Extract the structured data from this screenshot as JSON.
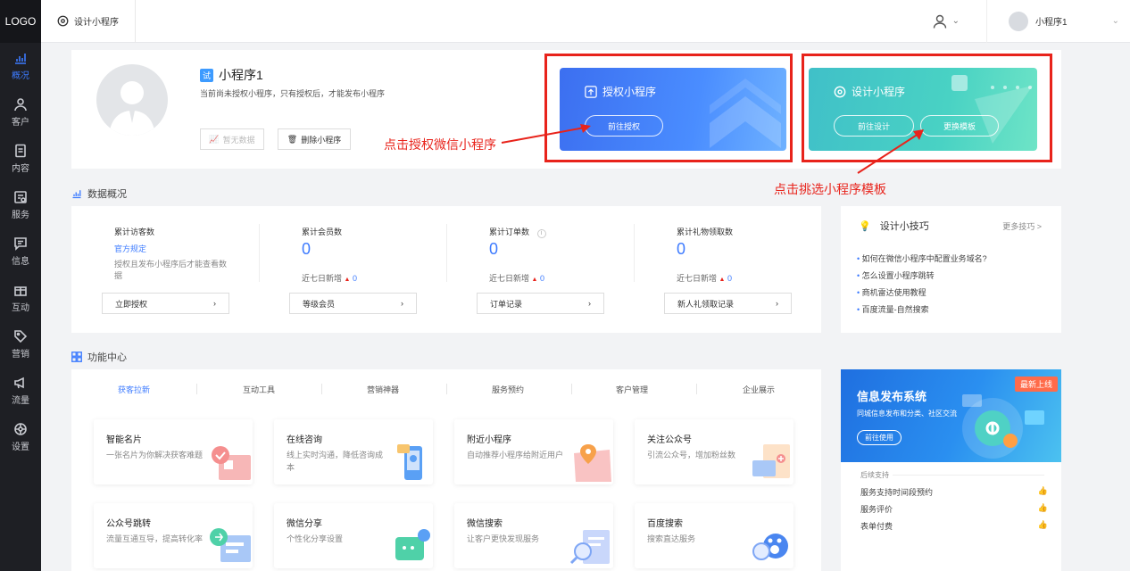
{
  "sidebar": {
    "logo": "LOGO",
    "items": [
      {
        "label": "概况",
        "icon": "chart-icon",
        "active": true
      },
      {
        "label": "客户",
        "icon": "person-icon"
      },
      {
        "label": "内容",
        "icon": "document-icon"
      },
      {
        "label": "服务",
        "icon": "service-icon"
      },
      {
        "label": "信息",
        "icon": "message-icon"
      },
      {
        "label": "互动",
        "icon": "gift-icon"
      },
      {
        "label": "营销",
        "icon": "tag-icon"
      },
      {
        "label": "流量",
        "icon": "megaphone-icon"
      },
      {
        "label": "设置",
        "icon": "settings-icon"
      }
    ]
  },
  "topbar": {
    "tab_label": "设计小程序",
    "account_name": "小程序1"
  },
  "profile": {
    "badge": "试",
    "app_name": "小程序1",
    "description": "当前尚未授权小程序，只有授权后，才能发布小程序",
    "no_data_label": "暂无数据",
    "delete_label": "删除小程序"
  },
  "auth_card": {
    "title": "授权小程序",
    "button": "前往授权"
  },
  "design_card": {
    "title": "设计小程序",
    "button_design": "前往设计",
    "button_template": "更换模板"
  },
  "annotations": {
    "auth_hint": "点击授权微信小程序",
    "template_hint": "点击挑选小程序模板",
    "color": "#e8231b"
  },
  "data_overview": {
    "title": "数据概况",
    "stats": [
      {
        "label": "累计访客数",
        "value": "官方规定",
        "note": "授权且发布小程序后才能查看数据",
        "button": "立即授权"
      },
      {
        "label": "累计会员数",
        "value": "0",
        "sub_label": "近七日新增",
        "sub_value": "0",
        "button": "等级会员"
      },
      {
        "label": "累计订单数",
        "value": "0",
        "sub_label": "近七日新增",
        "sub_value": "0",
        "button": "订单记录"
      },
      {
        "label": "累计礼物领取数",
        "value": "0",
        "sub_label": "近七日新增",
        "sub_value": "0",
        "button": "新人礼领取记录"
      }
    ]
  },
  "tips": {
    "title": "设计小技巧",
    "more": "更多技巧 >",
    "items": [
      "如何在微信小程序中配置业务域名?",
      "怎么设置小程序跳转",
      "商机雷达使用教程",
      "百度流量-自然搜索"
    ]
  },
  "function_center": {
    "title": "功能中心",
    "tabs": [
      "获客拉新",
      "互动工具",
      "营销神器",
      "服务预约",
      "客户管理",
      "企业展示"
    ],
    "cards": [
      {
        "title": "智能名片",
        "desc": "一张名片为你解决获客难题"
      },
      {
        "title": "在线咨询",
        "desc": "线上实时沟通，降低咨询成本"
      },
      {
        "title": "附近小程序",
        "desc": "自动推荐小程序给附近用户"
      },
      {
        "title": "关注公众号",
        "desc": "引流公众号，增加粉丝数"
      },
      {
        "title": "公众号跳转",
        "desc": "流量互通互导，提高转化率"
      },
      {
        "title": "微信分享",
        "desc": "个性化分享设置"
      },
      {
        "title": "微信搜索",
        "desc": "让客户更快发现服务"
      },
      {
        "title": "百度搜索",
        "desc": "搜索直达服务"
      }
    ]
  },
  "promo": {
    "ribbon": "最新上线",
    "title": "信息发布系统",
    "subtitle": "同城信息发布和分类、社区交流",
    "button": "前往使用",
    "support_title": "后续支持",
    "support_items": [
      "服务支持时间段预约",
      "服务评价",
      "表单付费"
    ]
  }
}
